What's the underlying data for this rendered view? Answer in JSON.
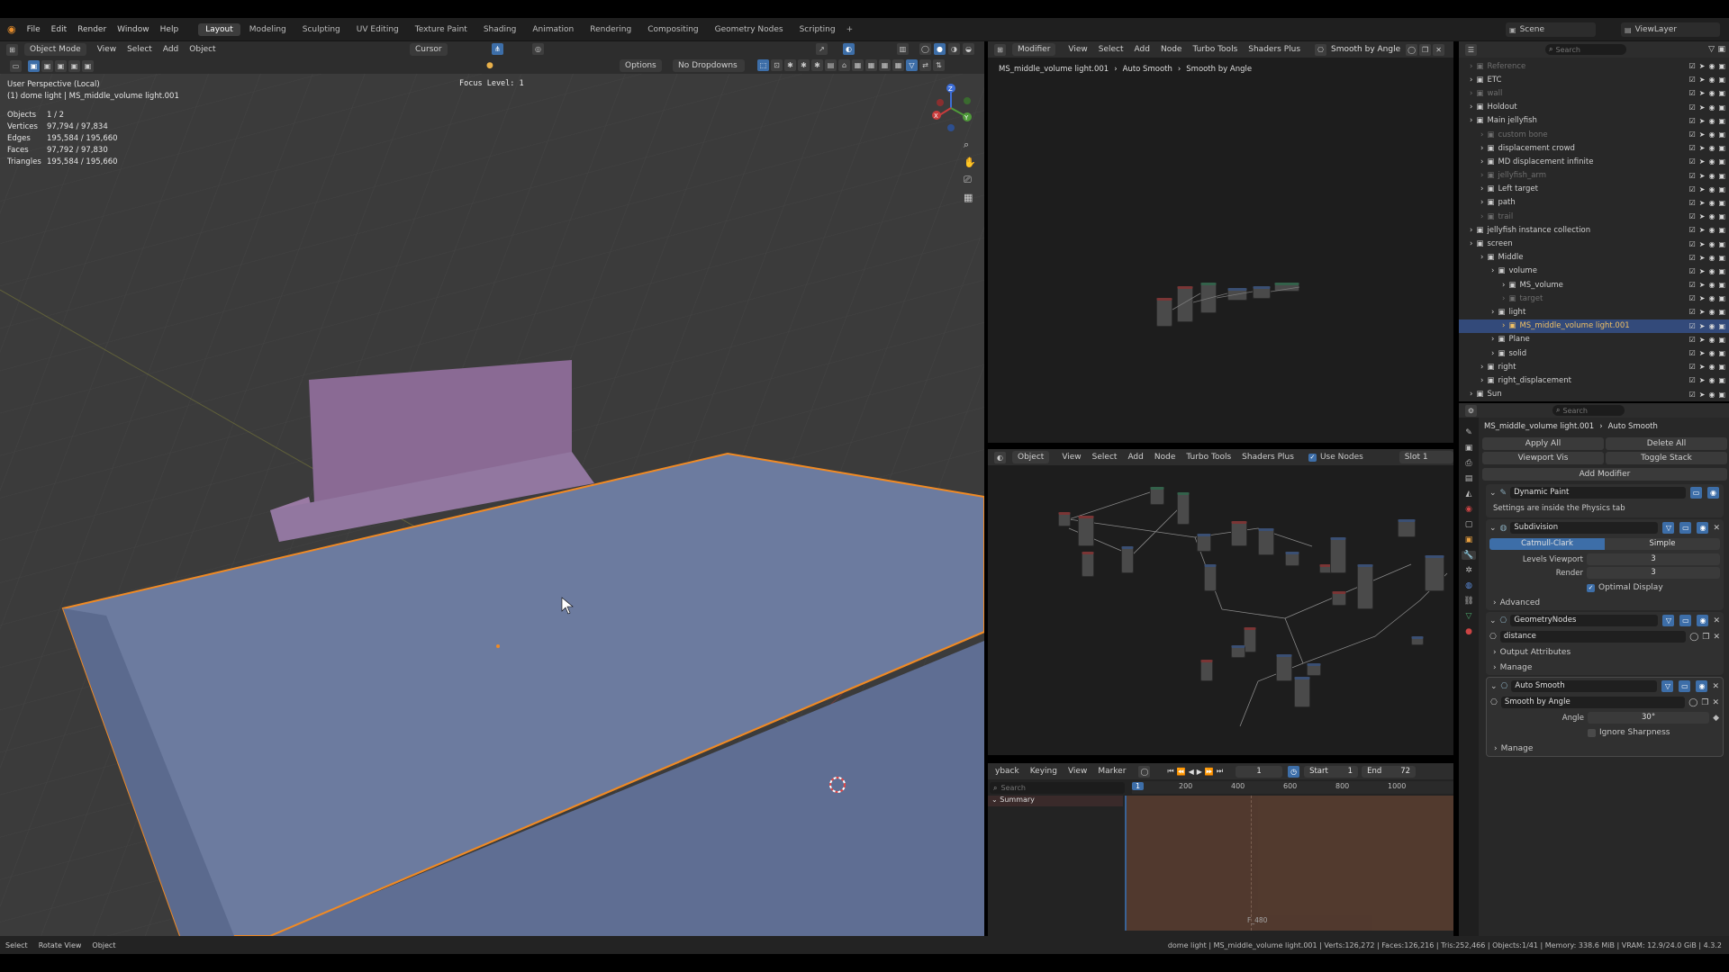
{
  "topbar": {
    "menus": [
      "File",
      "Edit",
      "Render",
      "Window",
      "Help"
    ],
    "workspaces": [
      "Layout",
      "Modeling",
      "Sculpting",
      "UV Editing",
      "Texture Paint",
      "Shading",
      "Animation",
      "Rendering",
      "Compositing",
      "Geometry Nodes",
      "Scripting"
    ],
    "add_tab": "+",
    "scene_label": "Scene",
    "viewlayer_label": "ViewLayer"
  },
  "viewport": {
    "mode": "Object Mode",
    "menus": [
      "View",
      "Select",
      "Add",
      "Object"
    ],
    "pivot": "Cursor",
    "options_label": "Options",
    "dropdown_label": "No Dropdowns",
    "focus_level": "Focus Level: 1",
    "overlay_title": "User Perspective (Local)",
    "overlay_sub": "(1) dome light | MS_middle_volume light.001",
    "stats": [
      {
        "k": "Objects",
        "v": "1 / 2"
      },
      {
        "k": "Vertices",
        "v": "97,794 / 97,834"
      },
      {
        "k": "Edges",
        "v": "195,584 / 195,660"
      },
      {
        "k": "Faces",
        "v": "97,792 / 97,830"
      },
      {
        "k": "Triangles",
        "v": "195,584 / 195,660"
      }
    ],
    "gizmo": {
      "x": "X",
      "y": "Y",
      "z": "Z"
    }
  },
  "node_editor_top": {
    "editor_label": "Modifier",
    "menus": [
      "View",
      "Select",
      "Add",
      "Node",
      "Turbo Tools",
      "Shaders Plus"
    ],
    "tree_name": "Smooth by Angle",
    "breadcrumb": [
      "MS_middle_volume light.001",
      "Auto Smooth",
      "Smooth by Angle"
    ]
  },
  "node_editor_bottom": {
    "editor_label": "Object",
    "menus": [
      "View",
      "Select",
      "Add",
      "Node",
      "Turbo Tools",
      "Shaders Plus"
    ],
    "use_nodes": "Use Nodes",
    "slot": "Slot 1"
  },
  "timeline": {
    "menus": [
      "yback",
      "Keying",
      "View",
      "Marker"
    ],
    "current_frame": "1",
    "start_label": "Start",
    "start": "1",
    "end_label": "End",
    "end": "72",
    "search_placeholder": "Search",
    "ticks": [
      "200",
      "400",
      "600",
      "800",
      "1000"
    ],
    "frame_marker": "1",
    "summary": "Summary",
    "marker_label": "F_480"
  },
  "outliner": {
    "search_placeholder": "Search",
    "rows": [
      {
        "label": "Reference",
        "indent": 1,
        "dim": true,
        "sel": false
      },
      {
        "label": "ETC",
        "indent": 1,
        "dim": false,
        "sel": false
      },
      {
        "label": "wall",
        "indent": 1,
        "dim": true,
        "sel": false
      },
      {
        "label": "Holdout",
        "indent": 1,
        "dim": false,
        "sel": false
      },
      {
        "label": "Main jellyfish",
        "indent": 1,
        "dim": false,
        "sel": false
      },
      {
        "label": "custom bone",
        "indent": 2,
        "dim": true,
        "sel": false
      },
      {
        "label": "displacement crowd",
        "indent": 2,
        "dim": false,
        "sel": false
      },
      {
        "label": "MD displacement infinite",
        "indent": 2,
        "dim": false,
        "sel": false
      },
      {
        "label": "jellyfish_arm",
        "indent": 2,
        "dim": true,
        "sel": false
      },
      {
        "label": "Left target",
        "indent": 2,
        "dim": false,
        "sel": false
      },
      {
        "label": "path",
        "indent": 2,
        "dim": false,
        "sel": false
      },
      {
        "label": "trail",
        "indent": 2,
        "dim": true,
        "sel": false
      },
      {
        "label": "jellyfish instance collection",
        "indent": 1,
        "dim": false,
        "sel": false
      },
      {
        "label": "screen",
        "indent": 1,
        "dim": false,
        "sel": false
      },
      {
        "label": "Middle",
        "indent": 2,
        "dim": false,
        "sel": false
      },
      {
        "label": "volume",
        "indent": 3,
        "dim": false,
        "sel": false
      },
      {
        "label": "MS_volume",
        "indent": 4,
        "dim": false,
        "sel": false
      },
      {
        "label": "target",
        "indent": 4,
        "dim": true,
        "sel": false
      },
      {
        "label": "light",
        "indent": 3,
        "dim": false,
        "sel": false
      },
      {
        "label": "MS_middle_volume light.001",
        "indent": 4,
        "dim": false,
        "sel": true
      },
      {
        "label": "Plane",
        "indent": 3,
        "dim": false,
        "sel": false
      },
      {
        "label": "solid",
        "indent": 3,
        "dim": false,
        "sel": false
      },
      {
        "label": "right",
        "indent": 2,
        "dim": false,
        "sel": false
      },
      {
        "label": "right_displacement",
        "indent": 2,
        "dim": false,
        "sel": false
      },
      {
        "label": "Sun",
        "indent": 1,
        "dim": false,
        "sel": false
      }
    ]
  },
  "properties": {
    "search_placeholder": "Search",
    "breadcrumb": [
      "MS_middle_volume light.001",
      "Auto Smooth"
    ],
    "apply_all": "Apply All",
    "delete_all": "Delete All",
    "viewport_vis": "Viewport Vis",
    "toggle_stack": "Toggle Stack",
    "add_modifier": "Add Modifier",
    "dynamic_paint": {
      "name": "Dynamic Paint",
      "note": "Settings are inside the Physics tab"
    },
    "subdivision": {
      "name": "Subdivision",
      "catmull": "Catmull-Clark",
      "simple": "Simple",
      "levels_label": "Levels Viewport",
      "levels": "3",
      "render_label": "Render",
      "render": "3",
      "optimal": "Optimal Display",
      "advanced": "Advanced"
    },
    "geometry_nodes": {
      "name": "GeometryNodes",
      "tree": "distance",
      "output_attributes": "Output Attributes",
      "manage": "Manage"
    },
    "auto_smooth": {
      "name": "Auto Smooth",
      "tree": "Smooth by Angle",
      "angle_label": "Angle",
      "angle": "30°",
      "ignore_sharpness": "Ignore Sharpness",
      "manage": "Manage"
    }
  },
  "statusbar": {
    "left": [
      "Select",
      "Rotate View",
      "Object"
    ],
    "right": "dome light | MS_middle_volume light.001 | Verts:126,272 | Faces:126,216 | Tris:252,466 | Objects:1/41 | Memory: 338.6 MiB | VRAM: 12.9/24.0 GiB | 4.3.2"
  },
  "colors": {
    "selection_outline": "#f08a24",
    "mesh_blue": "#6c7b9f",
    "mesh_purple": "#8a6a94",
    "accent_blue": "#3d6ea8"
  }
}
